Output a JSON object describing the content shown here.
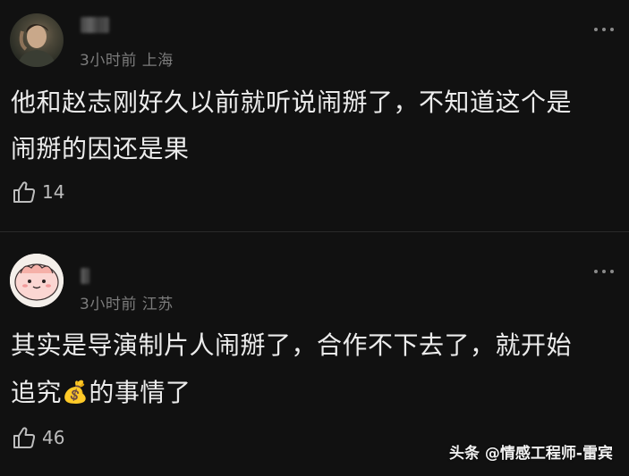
{
  "comments": [
    {
      "meta": "3小时前 上海",
      "line1": "他和赵志刚好久以前就听说闹掰了，不知道这个是",
      "line2": "闹掰的因还是果",
      "likes": "14"
    },
    {
      "meta": "3小时前 江苏",
      "line1": "其实是导演制片人闹掰了，合作不下去了，就开始",
      "line2_a": "追究",
      "emoji": "💰",
      "line2_b": "的事情了",
      "likes": "46"
    }
  ],
  "watermark": "头条 @情感工程师-雷宾",
  "icons": [
    "avatar",
    "more-dots-icon",
    "thumbs-up-icon",
    "money-bag-emoji"
  ]
}
